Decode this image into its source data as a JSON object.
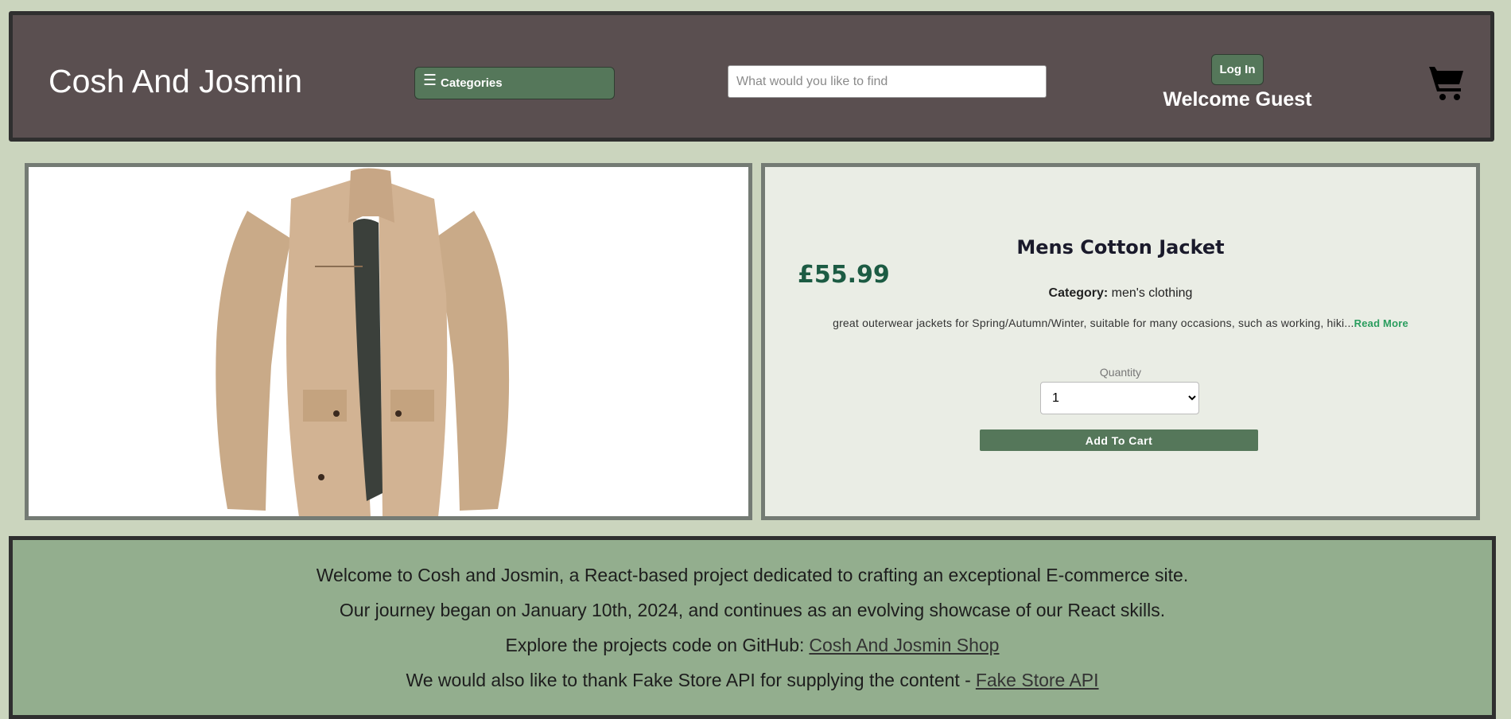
{
  "header": {
    "brand": "Cosh And Josmin",
    "categories_label": "Categories",
    "search_placeholder": "What would you like to find",
    "login_label": "Log In",
    "welcome_text": "Welcome Guest"
  },
  "product": {
    "image_alt": "Mens Cotton Jacket",
    "price": "£55.99",
    "title": "Mens Cotton Jacket",
    "category_label": "Category:",
    "category_value": "men's clothing",
    "description": "great outerwear jackets for Spring/Autumn/Winter, suitable for many occasions, such as working, hiki...",
    "read_more": "Read More",
    "quantity_label": "Quantity",
    "quantity_value": "1",
    "add_to_cart": "Add To Cart"
  },
  "footer": {
    "line1": "Welcome to Cosh and Josmin, a React-based project dedicated to crafting an exceptional E-commerce site.",
    "line2": "Our journey began on January 10th, 2024, and continues as an evolving showcase of our React skills.",
    "line3": "Explore the projects code on GitHub:",
    "github_link": "Cosh And Josmin Shop",
    "line4": "We would also like to thank Fake Store API for supplying the content -",
    "api_link": "Fake Store API"
  },
  "colors": {
    "page_bg": "#cbd5be",
    "header_bg": "#5a4f50",
    "accent_green": "#55775a",
    "price_green": "#1c5b43",
    "footer_bg": "#93ae8e",
    "read_more": "#2a9d5e"
  },
  "icons": [
    "menu-icon",
    "cart-icon"
  ]
}
